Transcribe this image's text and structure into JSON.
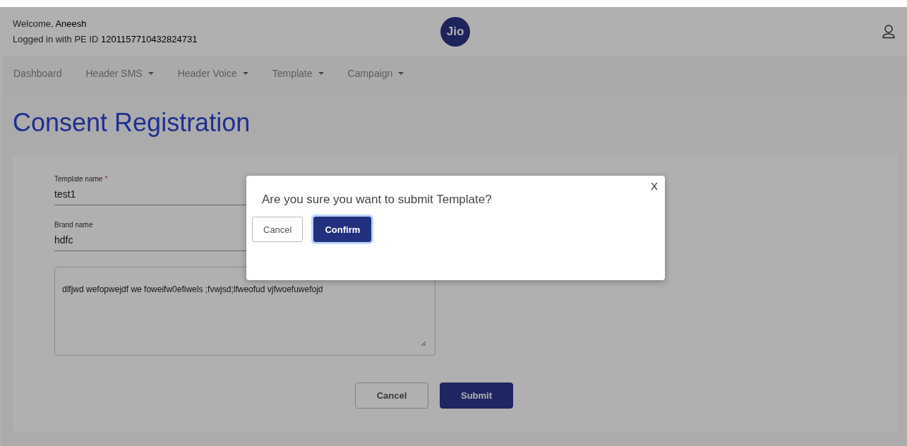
{
  "header": {
    "welcome_label": "Welcome,",
    "user_name": "Aneesh",
    "login_label": "Logged in with PE ID",
    "pe_id": "1201157710432824731",
    "logo_text": "Jio"
  },
  "nav": [
    {
      "label": "Dashboard",
      "dropdown": false
    },
    {
      "label": "Header SMS",
      "dropdown": true
    },
    {
      "label": "Header Voice",
      "dropdown": true
    },
    {
      "label": "Template",
      "dropdown": true
    },
    {
      "label": "Campaign",
      "dropdown": true
    }
  ],
  "page_title": "Consent Registration",
  "form": {
    "fields": [
      {
        "label": "Template name",
        "required_mark": "*",
        "value": "test1"
      },
      {
        "label": "Brand name",
        "value": "hdfc"
      }
    ],
    "message": "dlfjwd wefopwejdf we foweifw0efiwels ;fvwjsd;lfweofud vjfwoefuwefojd",
    "buttons": [
      {
        "label": "Cancel",
        "kind": "secondary"
      },
      {
        "label": "Submit",
        "kind": "primary"
      }
    ]
  },
  "dialog": {
    "close": "X",
    "message": "Are you sure you want to submit Template?",
    "buttons": [
      {
        "label": "Cancel",
        "kind": "secondary"
      },
      {
        "label": "Confirm",
        "kind": "primary"
      }
    ]
  }
}
